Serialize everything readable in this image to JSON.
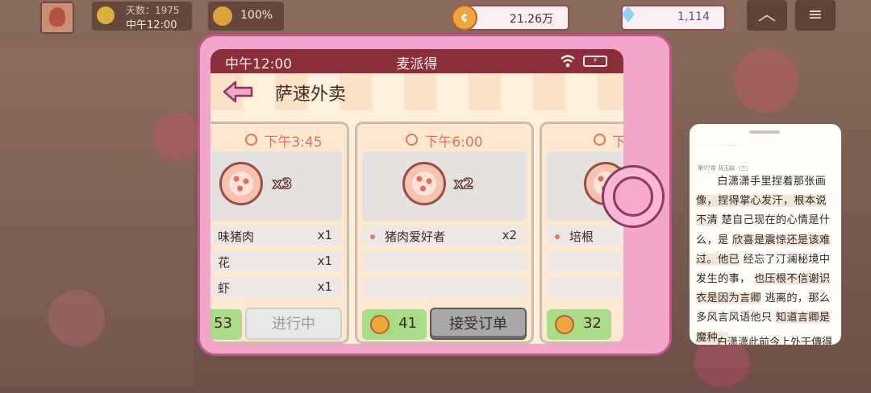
{
  "hud": {
    "day_label": "天数：1975",
    "time": "中午12:00",
    "satisfaction": "100%",
    "coins": "21.26万",
    "gems": "1,114"
  },
  "phone": {
    "status_time": "中午12:00",
    "status_title": "麦派得",
    "app_title": "萨速外卖",
    "orders": [
      {
        "time": "下午3:45",
        "pizza_qty": "x3",
        "items": [
          {
            "name": "味猪肉",
            "qty": "x1"
          },
          {
            "name": "花",
            "qty": "x1"
          },
          {
            "name": "虾",
            "qty": "x1"
          }
        ],
        "price": "53",
        "button": "进行中"
      },
      {
        "time": "下午6:00",
        "pizza_qty": "x2",
        "items": [
          {
            "name": "猪肉爱好者",
            "qty": "x2"
          }
        ],
        "price": "41",
        "button": "接受订单"
      },
      {
        "time": "下",
        "items": [
          {
            "name": "培根",
            "qty": ""
          }
        ],
        "price": "32"
      }
    ]
  },
  "reader": {
    "chapter": "第97章 背玉缺（三）",
    "lines": [
      "白潇潇手里捏着那张画",
      "像，捏得掌心发汗，根本说不清",
      "楚自己现在的心情是什么，是",
      "欣喜是震惊还是该难过。他已",
      "经忘了汀澜秘境中发生的事，",
      "也压根不信谢识衣是因为言卿",
      "逃离的，那么多风言风语他只",
      "知道言卿是魔种。"
    ],
    "next_line": "白潇潇此前今上外干傳得"
  },
  "colors": {
    "phone_frame": "#f2a6cc",
    "status_bar": "#8a2f3a",
    "time_text": "#e0735a",
    "price_green": "#a9dc86"
  }
}
